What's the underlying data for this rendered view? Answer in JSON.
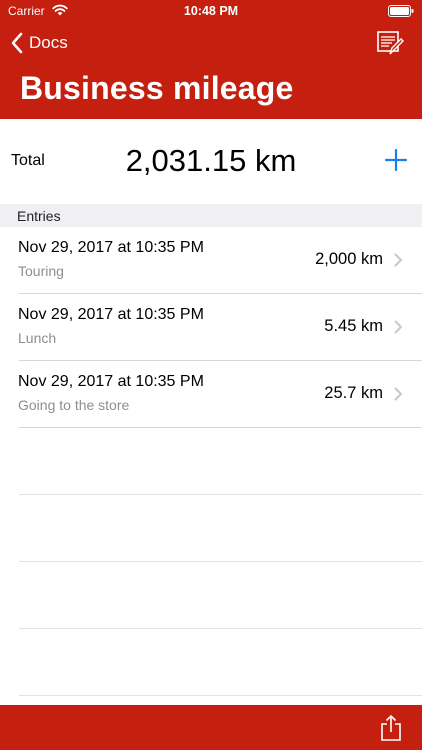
{
  "status_bar": {
    "carrier": "Carrier",
    "time": "10:48 PM"
  },
  "nav": {
    "back_label": "Docs",
    "title": "Business mileage"
  },
  "summary": {
    "total_label": "Total",
    "total_value": "2,031.15 km"
  },
  "section": {
    "label": "Entries"
  },
  "entries": [
    {
      "date": "Nov 29, 2017 at 10:35 PM",
      "note": "Touring",
      "distance": "2,000 km"
    },
    {
      "date": "Nov 29, 2017 at 10:35 PM",
      "note": "Lunch",
      "distance": "5.45 km"
    },
    {
      "date": "Nov 29, 2017 at 10:35 PM",
      "note": "Going to the store",
      "distance": "25.7 km"
    }
  ],
  "colors": {
    "brand": "#c41f0f",
    "accent": "#1a7ef0",
    "secondary_text": "#8e8e93",
    "section_bg": "#efeff4"
  },
  "icons": [
    "wifi-icon",
    "battery-icon",
    "chevron-left-icon",
    "notes-icon",
    "plus-icon",
    "chevron-right-icon",
    "share-icon"
  ]
}
